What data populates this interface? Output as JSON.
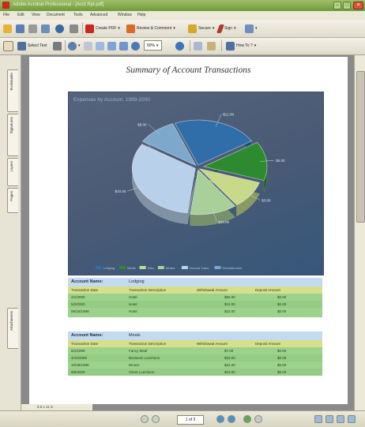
{
  "window": {
    "title": "Adobe Acrobat Professional - [Acct Rpt.pdf]"
  },
  "menu": [
    "File",
    "Edit",
    "View",
    "Document",
    "Tools",
    "Advanced",
    "Window",
    "Help"
  ],
  "toolbar1": {
    "create_pdf": "Create PDF",
    "review": "Review & Comment",
    "secure": "Secure",
    "sign": "Sign"
  },
  "toolbar2": {
    "select_text": "Select Text",
    "zoom": "80%",
    "how_to": "How To ?"
  },
  "side_tabs": [
    "Bookmarks",
    "Signatures",
    "Layers",
    "Pages",
    "Attachments"
  ],
  "document": {
    "title": "Summary of Account Transactions",
    "chart_data": {
      "type": "pie",
      "title": "Expenses by Account, 1999-2000",
      "slices": [
        {
          "name": "Lodging",
          "value": 22,
          "color": "#2f6ea8"
        },
        {
          "name": "Meals",
          "value": 14,
          "color": "#2e8a2e"
        },
        {
          "name": "Misc",
          "value": 10,
          "color": "#c8d98a"
        },
        {
          "name": "Airfare",
          "value": 12,
          "color": "#a8d098"
        },
        {
          "name": "Ground Trans",
          "value": 32,
          "color": "#b8d0ea"
        },
        {
          "name": "Entertainment",
          "value": 10,
          "color": "#7ea7cc"
        }
      ],
      "slice_labels": [
        "$12.00",
        "$6.00",
        "$3.00",
        "$15.00",
        "$10.00",
        "$8.00"
      ],
      "legend_position": "bottom"
    },
    "tables": [
      {
        "account_label": "Account Name:",
        "account_name": "Lodging",
        "headers": [
          "Transaction Date",
          "Transaction Description",
          "Withdrawal Amount",
          "Deposit Amount"
        ],
        "rows": [
          [
            "2/1/2000",
            "Hotel",
            "$50.00",
            "$0.00"
          ],
          [
            "5/2/2000",
            "Hotel",
            "$15.00",
            "$0.00"
          ],
          [
            "06/16/1999",
            "Hotel",
            "$10.00",
            "$0.00"
          ]
        ]
      },
      {
        "account_label": "Account Name:",
        "account_name": "Meals",
        "headers": [
          "Transaction Date",
          "Transaction Description",
          "Withdrawal Amount",
          "Deposit Amount"
        ],
        "rows": [
          [
            "8/1/1999",
            "Fancy Meal",
            "$7.00",
            "$0.00"
          ],
          [
            "4/10/2000",
            "Business Luncheon",
            "$10.00",
            "$0.00"
          ],
          [
            "10/28/1999",
            "Dinner",
            "$22.00",
            "$0.00"
          ],
          [
            "9/5/2000",
            "Client Luncheon",
            "$10.00",
            "$0.00"
          ]
        ]
      }
    ]
  },
  "status": {
    "page_size": "8.5 x 11 in",
    "page_indicator": "1 of 3"
  }
}
